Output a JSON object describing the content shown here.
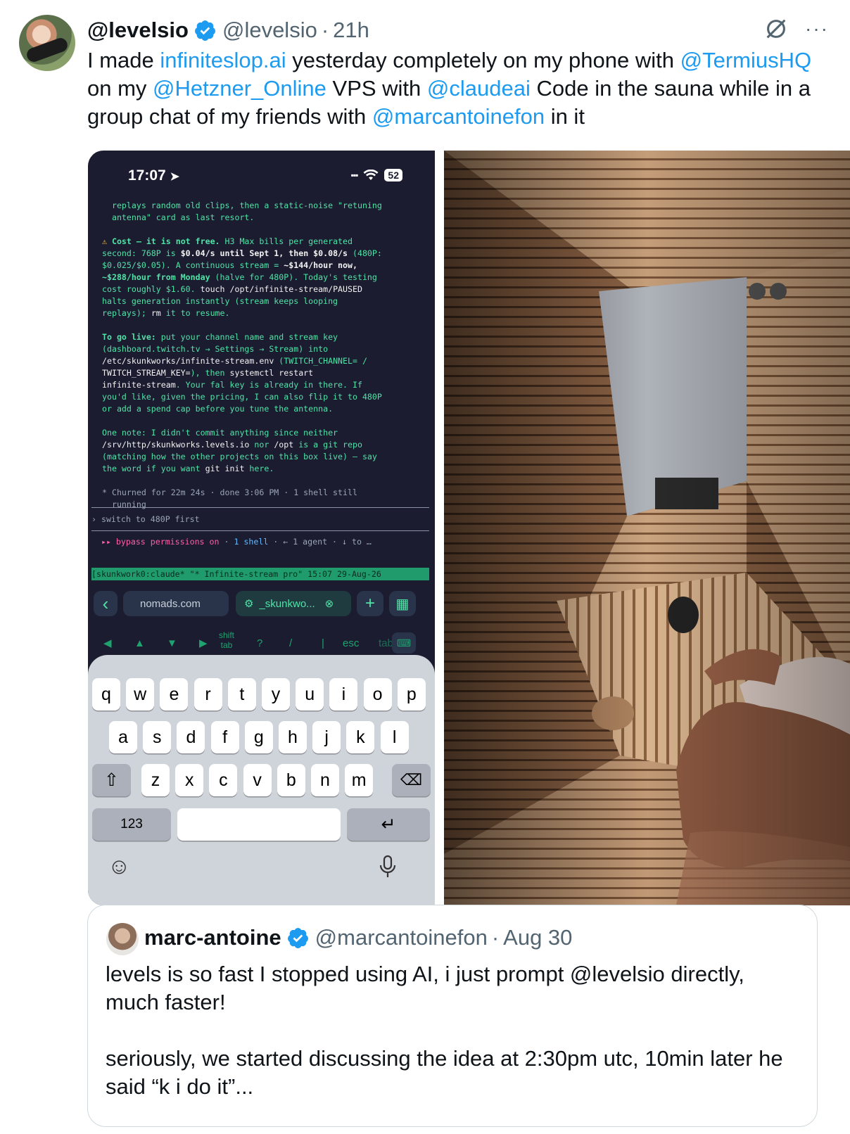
{
  "tweet": {
    "display_name": "@levelsio",
    "handle": "@levelsio",
    "sep": "·",
    "time": "21h",
    "more": "···",
    "text": {
      "t1": "I made ",
      "l1": "infiniteslop.ai",
      "t2": " yesterday completely on my phone with ",
      "l2": "@TermiusHQ",
      "t3": " on my ",
      "l3": "@Hetzner_Online",
      "t4": " VPS with ",
      "l4": "@claudeai",
      "t5": " Code in the sauna while in a group chat of my friends with ",
      "l5": "@marcantoinefon",
      "t6": " in it"
    }
  },
  "phone": {
    "time": "17:07",
    "battery": "52",
    "terminal": {
      "l1": "  replays random old clips, then a static-noise \"retuning",
      "l2": "  antenna\" card as last resort.",
      "cost_warn": "⚠ ",
      "cost_head": "Cost — it is not free.",
      "cost_1": " H3 Max bills per generated",
      "cost_2a": "second: 768P is ",
      "cost_2b": "$0.04/s until Sept 1, then $0.08/s",
      "cost_2c": " (480P:",
      "cost_3a": "$0.025/$0.05). A continuous stream = ",
      "cost_3b": "~$144/hour now,",
      "cost_4a": "~$288/hour from Monday",
      "cost_4b": " (halve for 480P). Today's testing",
      "cost_5a": "cost roughly $1.60. ",
      "cost_5b": "touch /opt/infinite-stream/PAUSED",
      "cost_6": "halts generation instantly (stream keeps looping",
      "cost_7a": "replays); ",
      "cost_7b": "rm",
      "cost_7c": " it to resume.",
      "live_head": "To go live:",
      "live_1": " put your channel name and stream key",
      "live_2": "(dashboard.twitch.tv → Settings → Stream) into",
      "live_3a": "/etc/skunkworks/infinite-stream.env",
      "live_3b": " (TWITCH_CHANNEL= /",
      "live_4a": "TWITCH_STREAM_KEY=",
      "live_4b": "), then ",
      "live_4c": "systemctl restart",
      "live_5a": "infinite-stream",
      "live_5b": ". Your fal key is already in there. If",
      "live_6": "you'd like, given the pricing, I can also flip it to 480P",
      "live_7": "or add a spend cap before you tune the antenna.",
      "note_1": "One note: I didn't commit anything since neither",
      "note_2a": "/srv/http/skunkworks.levels.io",
      "note_2b": " nor ",
      "note_2c": "/opt",
      "note_2d": " is a git repo",
      "note_3": "(matching how the other projects on this box live) — say",
      "note_4a": "the word if you want ",
      "note_4b": "git init",
      "note_4c": " here.",
      "churn_1": "* Churned for 22m 24s · done 3:06 PM · 1 shell still",
      "churn_2": "  running",
      "prompt": "› switch to 480P first",
      "bypass_a": "  ▸▸ bypass permissions on",
      "bypass_b": " · ",
      "bypass_c": "1 shell",
      "bypass_d": " · ← 1 agent · ↓ to …",
      "tmux": "[skunkwork0:claude* \"* Infinite-stream pro\" 15:07 29-Aug-26"
    },
    "nav": {
      "back": "‹",
      "url": "nomads.com",
      "tab": "_skunkwo...",
      "plus": "+",
      "grid": "▦"
    },
    "extra_keys": {
      "left": "◀",
      "up": "▲",
      "down": "▼",
      "right": "▶",
      "shift": "shift",
      "tab_small": "tab",
      "q": "?",
      "slash": "/",
      "pipe": "|",
      "esc": "esc",
      "tab": "tab"
    },
    "keyboard": {
      "row1": [
        "q",
        "w",
        "e",
        "r",
        "t",
        "y",
        "u",
        "i",
        "o",
        "p"
      ],
      "row2": [
        "a",
        "s",
        "d",
        "f",
        "g",
        "h",
        "j",
        "k",
        "l"
      ],
      "row3": [
        "z",
        "x",
        "c",
        "v",
        "b",
        "n",
        "m"
      ],
      "num": "123",
      "shift": "⇧",
      "delete": "⌫",
      "return": "↵",
      "emoji": "☺",
      "mic": "🎙"
    }
  },
  "quote": {
    "display_name": "marc-antoine",
    "handle": "@marcantoinefon",
    "sep": "·",
    "time": "Aug 30",
    "text": "levels is so fast I stopped using AI, i just prompt @levelsio directly, much faster!\n\nseriously, we started discussing the idea at 2:30pm utc, 10min later he said “k i do it”..."
  },
  "colors": {
    "link": "#1d9bf0",
    "terminal_green": "#4fe3a6",
    "terminal_bg": "#1b1c30"
  }
}
